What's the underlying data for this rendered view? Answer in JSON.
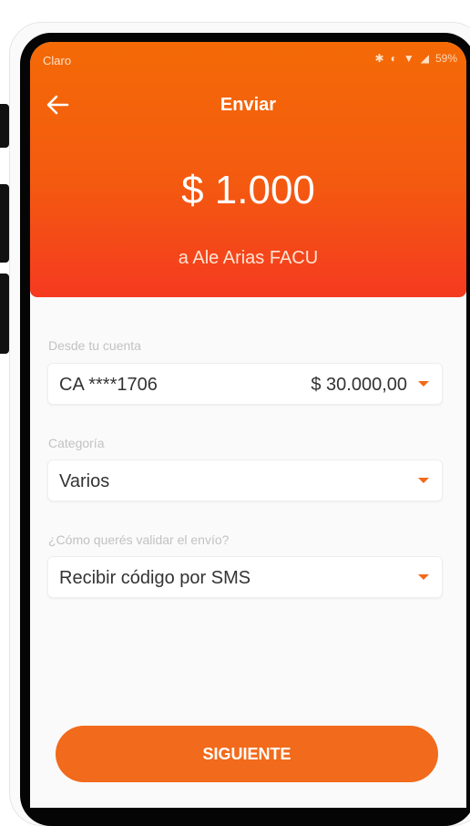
{
  "status_bar": {
    "carrier": "Claro",
    "battery": "59%"
  },
  "header": {
    "back_icon": "arrow-left-icon",
    "title": "Enviar",
    "amount": "$ 1.000",
    "recipient": "a Ale Arias FACU"
  },
  "form": {
    "account": {
      "label": "Desde tu cuenta",
      "value": "CA ****1706",
      "balance": "$ 30.000,00"
    },
    "category": {
      "label": "Categoría",
      "value": "Varios"
    },
    "validation": {
      "label": "¿Cómo querés validar el envío?",
      "value": "Recibir código por SMS"
    }
  },
  "actions": {
    "next_label": "SIGUIENTE"
  },
  "colors": {
    "brand_orange": "#f26a1b",
    "header_top": "#f46a06",
    "header_bottom": "#f53a20"
  }
}
